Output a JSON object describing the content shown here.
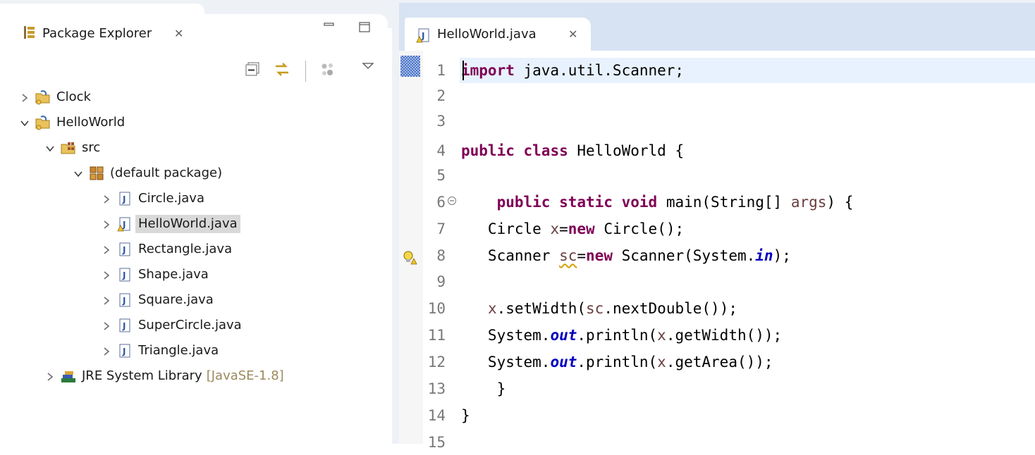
{
  "package_explorer": {
    "title": "Package Explorer",
    "close_glyph": "✕",
    "view_buttons": [
      "minimize-icon",
      "maximize-icon"
    ],
    "toolbar": [
      "collapse-all-icon",
      "link-with-editor-icon",
      "focus-on-active-task-icon",
      "view-menu-icon"
    ],
    "tree": [
      {
        "label": "Clock",
        "expanded": false,
        "icon": "java-project-icon",
        "depth": 0
      },
      {
        "label": "HelloWorld",
        "expanded": true,
        "icon": "java-project-icon",
        "depth": 0
      },
      {
        "label": "src",
        "expanded": true,
        "icon": "source-folder-icon",
        "depth": 1
      },
      {
        "label": "(default package)",
        "expanded": true,
        "icon": "package-icon",
        "depth": 2
      },
      {
        "label": "Circle.java",
        "expanded": false,
        "icon": "java-file-icon",
        "depth": 3
      },
      {
        "label": "HelloWorld.java",
        "expanded": false,
        "icon": "java-file-warning-icon",
        "depth": 3,
        "selected": true
      },
      {
        "label": "Rectangle.java",
        "expanded": false,
        "icon": "java-file-icon",
        "depth": 3
      },
      {
        "label": "Shape.java",
        "expanded": false,
        "icon": "java-file-icon",
        "depth": 3
      },
      {
        "label": "Square.java",
        "expanded": false,
        "icon": "java-file-icon",
        "depth": 3
      },
      {
        "label": "SuperCircle.java",
        "expanded": false,
        "icon": "java-file-icon",
        "depth": 3
      },
      {
        "label": "Triangle.java",
        "expanded": false,
        "icon": "java-file-icon",
        "depth": 3
      },
      {
        "label": "JRE System Library",
        "decoration": "[JavaSE-1.8]",
        "expanded": false,
        "icon": "library-icon",
        "depth": 1
      }
    ]
  },
  "editor": {
    "tab_label": "HelloWorld.java",
    "close_glyph": "✕",
    "current_line": 1,
    "lines": [
      {
        "num": "1",
        "code": "import java.util.Scanner;"
      },
      {
        "num": "2",
        "code": ""
      },
      {
        "num": "3",
        "code": ""
      },
      {
        "num": "4",
        "code": "public class HelloWorld {"
      },
      {
        "num": "5",
        "code": ""
      },
      {
        "num": "6",
        "code": "    public static void main(String[] args) {",
        "fold": true
      },
      {
        "num": "7",
        "code": "   Circle x=new Circle();"
      },
      {
        "num": "8",
        "code": "   Scanner sc=new Scanner(System.in);",
        "warning": true
      },
      {
        "num": "9",
        "code": ""
      },
      {
        "num": "10",
        "code": "   x.setWidth(sc.nextDouble());"
      },
      {
        "num": "11",
        "code": "   System.out.println(x.getWidth());"
      },
      {
        "num": "12",
        "code": "   System.out.println(x.getArea());"
      },
      {
        "num": "13",
        "code": "    }"
      },
      {
        "num": "14",
        "code": "}"
      },
      {
        "num": "15",
        "code": ""
      }
    ]
  },
  "colors": {
    "keyword": "#7f0055",
    "static_field": "#0000c0",
    "local_variable": "#6a3e3e",
    "line_number": "#787878",
    "current_line": "#e8f2fe",
    "selection": "#d9d9d9",
    "library_decoration": "#9b8a5e"
  }
}
